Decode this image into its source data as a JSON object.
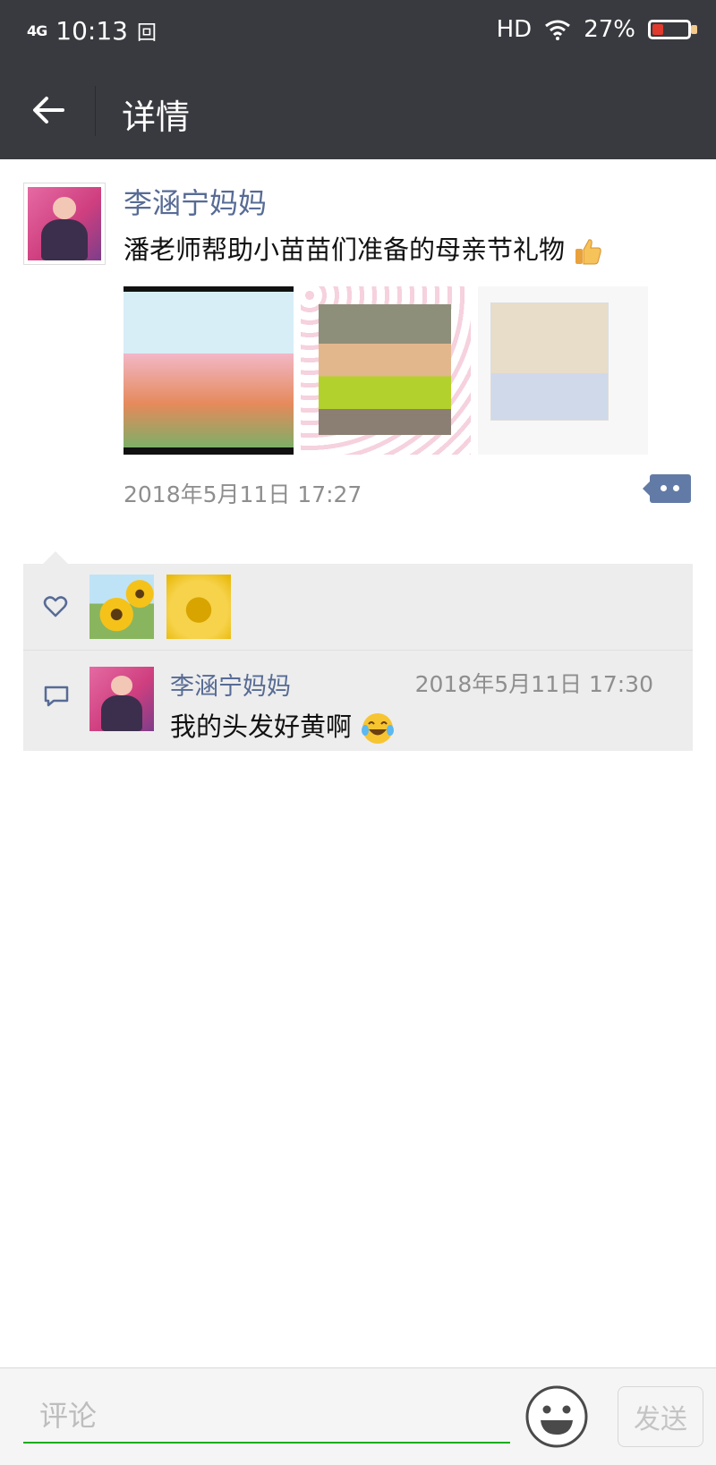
{
  "status_bar": {
    "network": "4G",
    "time": "10:13",
    "extra_icon": "回",
    "hd": "HD",
    "battery": "27%",
    "battery_level": 0.27
  },
  "header": {
    "title": "详情",
    "back_icon": "arrow-left-icon"
  },
  "post": {
    "author": "李涵宁妈妈",
    "content": "潘老师帮助小苗苗们准备的母亲节礼物",
    "timestamp": "2018年5月11日 17:27",
    "more_icon": "more-dots-icon"
  },
  "likes": {
    "icon": "heart-icon"
  },
  "comment": {
    "icon": "comment-icon",
    "author": "李涵宁妈妈",
    "time": "2018年5月11日 17:30",
    "text": "我的头发好黄啊"
  },
  "input_bar": {
    "placeholder": "评论",
    "send_label": "发送",
    "emoji_icon": "smiley-icon"
  },
  "colors": {
    "header_bg": "#393a3f",
    "link_blue": "#576b95",
    "accent_green": "#1aad19",
    "interaction_bg": "#ededed"
  }
}
